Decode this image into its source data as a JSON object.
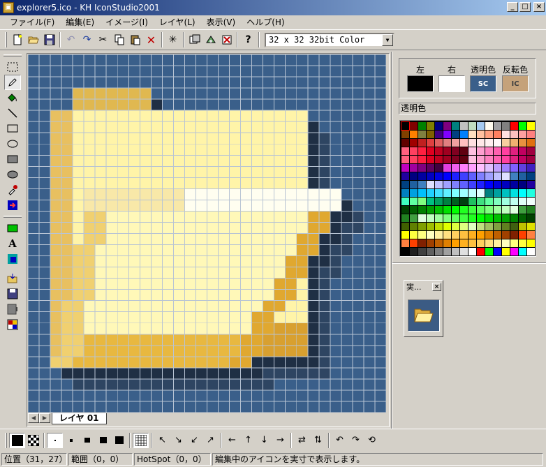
{
  "window": {
    "title": "explorer5.ico - KH IconStudio2001",
    "minimize": "_",
    "maximize": "□",
    "close": "×"
  },
  "menu": [
    {
      "id": "file",
      "label": "ファイル(F)"
    },
    {
      "id": "edit",
      "label": "編集(E)"
    },
    {
      "id": "image",
      "label": "イメージ(I)"
    },
    {
      "id": "layer",
      "label": "レイヤ(L)"
    },
    {
      "id": "view",
      "label": "表示(V)"
    },
    {
      "id": "help",
      "label": "ヘルプ(H)"
    }
  ],
  "toolbar": {
    "format_select": "32 x 32 32bit Color"
  },
  "colors": {
    "left_label": "左",
    "right_label": "右",
    "transparent_label": "透明色",
    "inverse_label": "反転色",
    "transparent_swatch": "SC",
    "inverse_swatch": "IC",
    "left_color": "#000000",
    "right_color": "#ffffff",
    "canvas_bg": "#3a5f8a"
  },
  "palette": {
    "title": "透明色"
  },
  "preview": {
    "title": "実..."
  },
  "layers": {
    "tab_label": "レイヤ 01"
  },
  "status": {
    "position": "位置（31，27）",
    "range": "範囲（0，0）",
    "hotspot": "HotSpot（0，0）",
    "message": "編集中のアイコンを実寸で表示します。"
  }
}
